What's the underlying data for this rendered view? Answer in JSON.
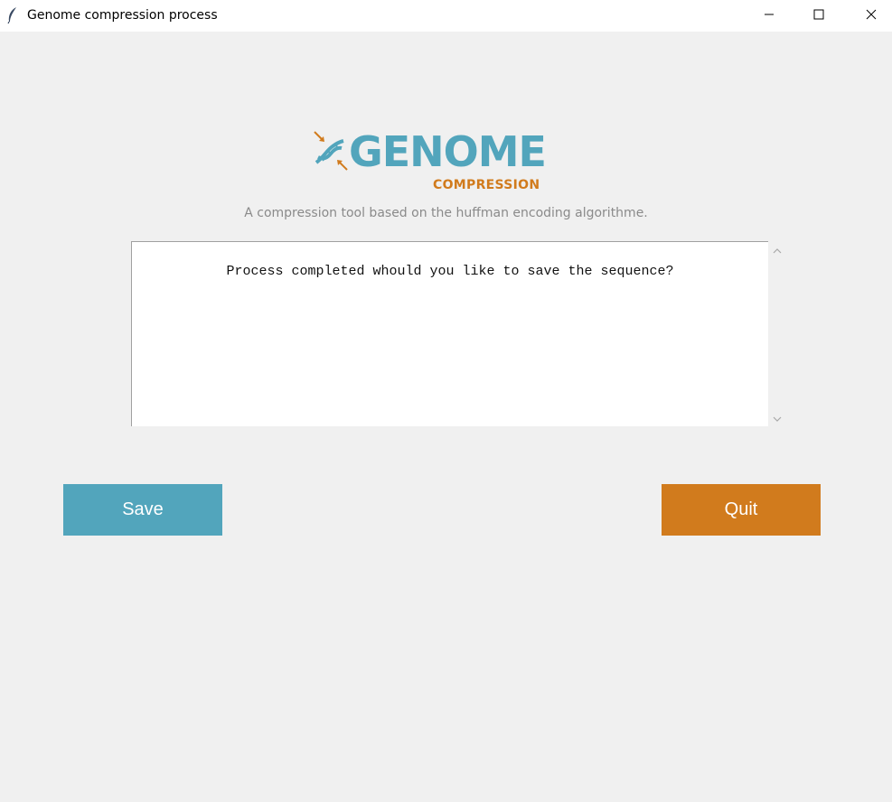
{
  "window": {
    "title": "Genome compression process",
    "icon": "feather-icon",
    "controls": [
      "minimize-icon",
      "maximize-icon",
      "close-icon"
    ]
  },
  "logo": {
    "word": "GENOME",
    "subword": "COMPRESSION",
    "mark_icon": "dna-compress-icon"
  },
  "tagline": "A compression tool based on the huffman encoding algorithme.",
  "output": {
    "text": "Process completed whould you like to save the sequence?"
  },
  "buttons": {
    "save_label": "Save",
    "quit_label": "Quit"
  },
  "colors": {
    "primary": "#52a5bc",
    "accent": "#d17b1d",
    "background": "#f0f0f0"
  }
}
